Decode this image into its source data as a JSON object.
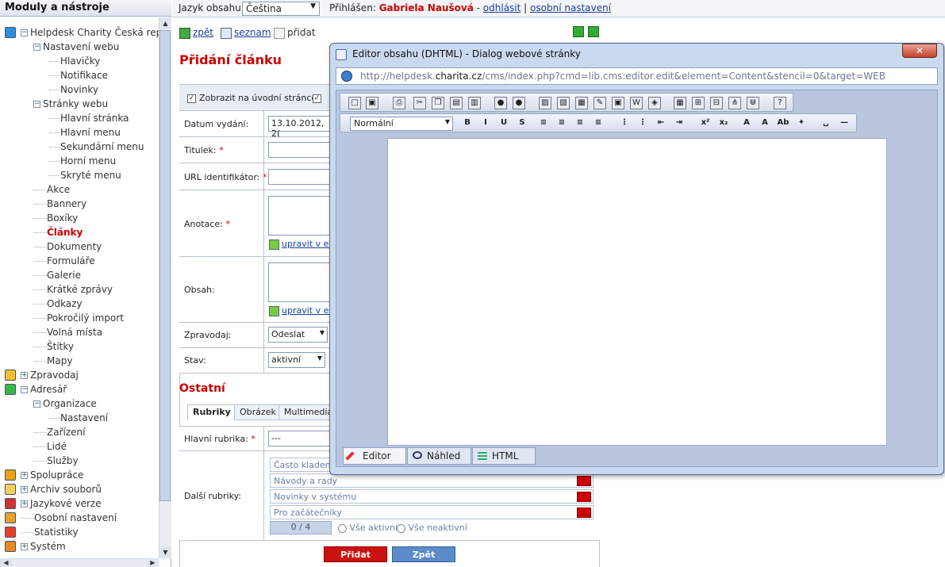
{
  "left_panel": {
    "title": "Moduly a nástroje",
    "tree": [
      {
        "label": "Helpdesk Charity Česká repub",
        "level": 0,
        "icon": "globe-icon",
        "exp": "−"
      },
      {
        "label": "Nastavení webu",
        "level": 1,
        "exp": "−"
      },
      {
        "label": "Hlavičky",
        "level": 2
      },
      {
        "label": "Notifikace",
        "level": 2
      },
      {
        "label": "Novinky",
        "level": 2
      },
      {
        "label": "Stránky webu",
        "level": 1,
        "exp": "−"
      },
      {
        "label": "Hlavní stránka",
        "level": 2
      },
      {
        "label": "Hlavní menu",
        "level": 2
      },
      {
        "label": "Sekundární menu",
        "level": 2
      },
      {
        "label": "Horní menu",
        "level": 2
      },
      {
        "label": "Skryté menu",
        "level": 2
      },
      {
        "label": "Akce",
        "level": 1
      },
      {
        "label": "Bannery",
        "level": 1
      },
      {
        "label": "Boxíky",
        "level": 1
      },
      {
        "label": "Články",
        "level": 1,
        "active": true
      },
      {
        "label": "Dokumenty",
        "level": 1
      },
      {
        "label": "Formuláře",
        "level": 1
      },
      {
        "label": "Galerie",
        "level": 1
      },
      {
        "label": "Krátké zprávy",
        "level": 1
      },
      {
        "label": "Odkazy",
        "level": 1
      },
      {
        "label": "Pokročilý import",
        "level": 1
      },
      {
        "label": "Volná místa",
        "level": 1
      },
      {
        "label": "Štítky",
        "level": 1
      },
      {
        "label": "Mapy",
        "level": 1
      },
      {
        "label": "Zpravodaj",
        "level": 0,
        "icon": "mail-icon",
        "exp": "+"
      },
      {
        "label": "Adresář",
        "level": 0,
        "icon": "address-book-icon",
        "exp": "−"
      },
      {
        "label": "Organizace",
        "level": 1,
        "exp": "−"
      },
      {
        "label": "Nastavení",
        "level": 2
      },
      {
        "label": "Zařízení",
        "level": 1
      },
      {
        "label": "Lidé",
        "level": 1
      },
      {
        "label": "Služby",
        "level": 1
      },
      {
        "label": "Spolupráce",
        "level": 0,
        "icon": "partners-icon",
        "exp": "+"
      },
      {
        "label": "Archiv souborů",
        "level": 0,
        "icon": "archive-icon",
        "exp": "+"
      },
      {
        "label": "Jazykové verze",
        "level": 0,
        "icon": "flag-icon",
        "exp": "+"
      },
      {
        "label": "Osobní nastavení",
        "level": 0,
        "icon": "user-icon"
      },
      {
        "label": "Statistiky",
        "level": 0,
        "icon": "chart-icon"
      },
      {
        "label": "Systém",
        "level": 0,
        "icon": "system-icon",
        "exp": "+"
      }
    ]
  },
  "topbar": {
    "lang_label": "Jazyk obsahu:",
    "lang_value": "Čeština",
    "logged_label": "Přihlášen:",
    "user": "Gabriela Naušová",
    "dash": "-",
    "logout": "odhlásit",
    "sep": "|",
    "settings": "osobní nastavení"
  },
  "toolbar": {
    "back": "zpět",
    "list": "seznam",
    "add": "přidat"
  },
  "form": {
    "title": "Přidání článku",
    "show_home": "Zobrazit na úvodní stránce",
    "date_label": "Datum vydání:",
    "date_value": "13.10.2012, 2(",
    "title_label": "Titulek:",
    "url_label": "URL identifikátor:",
    "annotation_label": "Anotace:",
    "content_label": "Obsah:",
    "edit_in_editor": "upravit v ed",
    "newsletter_label": "Zpravodaj:",
    "newsletter_value": "Odeslat",
    "state_label": "Stav:",
    "state_value": "aktivní",
    "other_heading": "Ostatní",
    "tabs": [
      "Rubriky",
      "Obrázek",
      "Multimediáln"
    ],
    "main_rubric_label": "Hlavní rubrika:",
    "main_rubric_value": "---",
    "other_rubrics_label": "Další rubriky:",
    "rubrics": [
      "Často kladené",
      "Návody a rady",
      "Novinky v systému",
      "Pro začátečníky"
    ],
    "counter": "0 / 4",
    "all_active": "Vše aktivní",
    "all_inactive": "Vše neaktivní",
    "submit": "Přidat",
    "back": "Zpět",
    "req": "*"
  },
  "dialog": {
    "title": "Editor obsahu (DHTML) - Dialog webové stránky",
    "close": "✕",
    "url_prefix": "http://helpdesk.",
    "url_host": "charita.cz",
    "url_rest": "/cms/index.php?cmd=lib.cms:editor.edit&element=Content&stencil=0&target=WEB",
    "format_value": "Normální",
    "modes": [
      "Editor",
      "Náhled",
      "HTML"
    ]
  },
  "colors": {
    "accent": "#cc0000",
    "link": "#1a3f9b",
    "button_red": "#cc1111",
    "button_blue": "#5b8bc9"
  }
}
